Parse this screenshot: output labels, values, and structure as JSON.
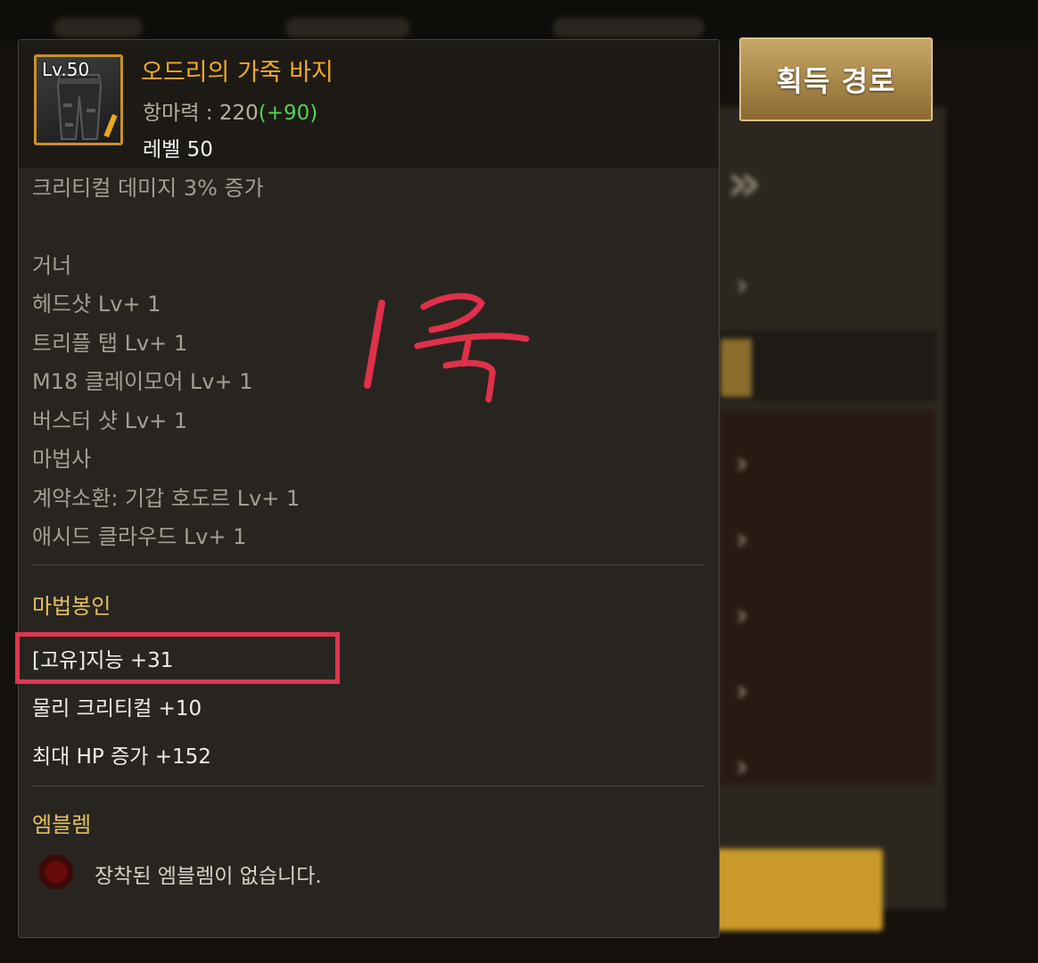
{
  "acquire_button": {
    "label": "획득 경로"
  },
  "item": {
    "level_badge": "Lv.50",
    "name": "오드리의 가죽 바지",
    "stat_label": "항마력 : 220",
    "stat_bonus": "(+90)",
    "required_level": "레벨 50"
  },
  "options": [
    "크리티컬 데미지 3% 증가",
    "거너",
    "헤드샷 Lv+ 1",
    "트리플 탭 Lv+ 1",
    "M18 클레이모어 Lv+ 1",
    "버스터 샷 Lv+ 1",
    "마법사",
    "계약소환: 기갑 호도르 Lv+ 1",
    "애시드 클라우드 Lv+ 1"
  ],
  "magic_seal": {
    "title": "마법봉인",
    "lines": [
      "[고유]지능 +31",
      "물리 크리티컬 +10",
      "최대 HP 증가 +152"
    ]
  },
  "emblem": {
    "title": "엠블렘",
    "empty_text": "장착된 엠블렘이 없습니다."
  },
  "colors": {
    "item_name": "#f0a828",
    "stat_bonus": "#55d055",
    "section_title": "#e6c060",
    "highlight_box": "#e0354f",
    "annotation_ink": "#e0304a"
  }
}
